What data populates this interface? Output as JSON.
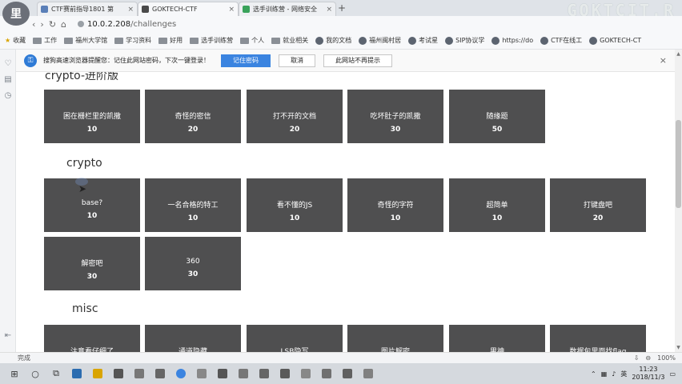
{
  "avatar": {
    "text": "里"
  },
  "watermark": "GOKTCIT.R",
  "tabs": [
    {
      "label": "CTF赛前指导1801 第",
      "color": "#5a7fb8"
    },
    {
      "label": "GOKTECH-CTF",
      "color": "#4a4a4a"
    },
    {
      "label": "选手训练营 - 网络安全",
      "color": "#3aa35b"
    }
  ],
  "address": {
    "host": "10.0.2.208",
    "path": "/challenges"
  },
  "bookmarks": [
    "收藏",
    "工作",
    "福州大学馆",
    "学习资料",
    "好用",
    "选手训练营",
    "个人",
    "就业相关",
    "我的文档",
    "福州闽村居",
    "考试星",
    "SIP协议学",
    "https://do",
    "CTF在线工",
    "GOKTECH-CT"
  ],
  "notification": {
    "message": "搜狗高速浏览器提醒您：记住此网站密码，下次一键登录！",
    "remember": "记住密码",
    "cancel": "取消",
    "never": "此网站不再提示"
  },
  "sections": [
    {
      "title": "crypto-进阶版",
      "cards": [
        {
          "name": "困在栅栏里的凯撒",
          "score": "10"
        },
        {
          "name": "奇怪的密信",
          "score": "20"
        },
        {
          "name": "打不开的文档",
          "score": "20"
        },
        {
          "name": "吃坏肚子的凯撒",
          "score": "30"
        },
        {
          "name": "随缘题",
          "score": "50"
        }
      ]
    },
    {
      "title": "crypto",
      "cards": [
        {
          "name": "base?",
          "score": "10"
        },
        {
          "name": "一名合格的特工",
          "score": "10"
        },
        {
          "name": "看不懂的JS",
          "score": "10"
        },
        {
          "name": "奇怪的字符",
          "score": "10"
        },
        {
          "name": "超简单",
          "score": "10"
        },
        {
          "name": "打键盘吧",
          "score": "20"
        },
        {
          "name": "解密吧",
          "score": "30"
        },
        {
          "name": "360",
          "score": "30"
        }
      ]
    },
    {
      "title": "misc",
      "cards": [
        {
          "name": "注意看仔细了",
          "score": ""
        },
        {
          "name": "通道隐藏",
          "score": ""
        },
        {
          "name": "LSB隐写",
          "score": ""
        },
        {
          "name": "图片解密",
          "score": ""
        },
        {
          "name": "男神",
          "score": ""
        },
        {
          "name": "数据包里面找flag",
          "score": ""
        }
      ]
    }
  ],
  "status": {
    "left": "完成",
    "zoom": "100%"
  },
  "clock": {
    "time": "11:23",
    "date": "2018/11/3",
    "ime": "英"
  }
}
